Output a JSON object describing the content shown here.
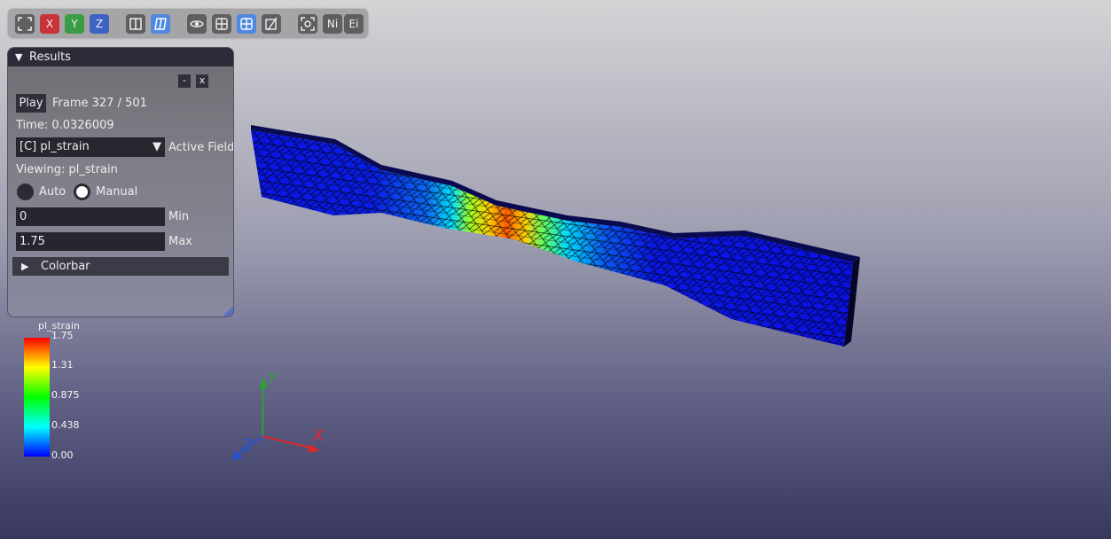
{
  "toolbar": {
    "buttons": [
      {
        "name": "fullscreen-icon",
        "label": ""
      },
      {
        "name": "view-x-button",
        "label": "X"
      },
      {
        "name": "view-y-button",
        "label": "Y"
      },
      {
        "name": "view-z-button",
        "label": "Z"
      },
      {
        "name": "orthographic-icon",
        "label": ""
      },
      {
        "name": "perspective-icon",
        "label": ""
      },
      {
        "name": "eye-icon",
        "label": ""
      },
      {
        "name": "grid-icon",
        "label": ""
      },
      {
        "name": "mesh-icon",
        "label": ""
      },
      {
        "name": "clip-icon",
        "label": ""
      },
      {
        "name": "screenshot-icon",
        "label": ""
      },
      {
        "name": "node-ids-button",
        "label": "Ni"
      },
      {
        "name": "element-ids-button",
        "label": "Ei"
      }
    ]
  },
  "panel": {
    "title": "Results",
    "minimize_label": "-",
    "close_label": "x",
    "play_label": "Play",
    "frame_text": "Frame 327 / 501",
    "time_text": "Time: 0.0326009",
    "field_select": "[C] pl_strain",
    "active_field_label": "Active Field",
    "viewing_text": "Viewing: pl_strain",
    "auto_label": "Auto",
    "manual_label": "Manual",
    "range_mode": "Manual",
    "min_value": "0",
    "min_label": "Min",
    "max_value": "1.75",
    "max_label": "Max",
    "colorbar_label": "Colorbar"
  },
  "legend": {
    "title": "pl_strain",
    "ticks": [
      "1.75",
      "1.31",
      "0.875",
      "0.438",
      "0.00"
    ]
  },
  "axes": {
    "x_label": "X",
    "y_label": "Y",
    "z_label": "Z",
    "x_color": "#e0262d",
    "y_color": "#2f9e3a",
    "z_color": "#2a52c8"
  },
  "colors": {
    "accent": "#4e88e0",
    "panel_header": "#2b2c37"
  }
}
